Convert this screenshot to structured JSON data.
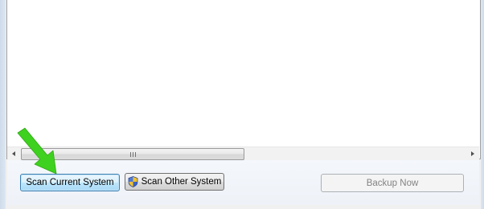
{
  "buttons": {
    "scan_current_label": "Scan Current System",
    "scan_other_label": "Scan Other System",
    "backup_label": "Backup Now"
  },
  "scrollbar": {
    "grip_label": "III"
  },
  "annotation": {
    "arrow_color": "#3fd11f",
    "icon": "green-arrow-icon"
  },
  "colors": {
    "focus_border": "#3c7fb1",
    "disabled_text": "#838383"
  }
}
